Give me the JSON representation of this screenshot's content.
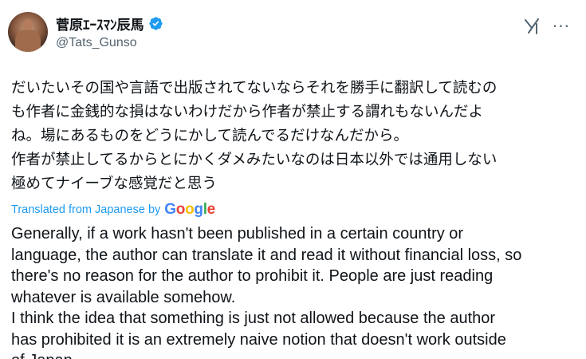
{
  "author": {
    "display_name": "菅原ｴｰｽﾏﾝ辰馬",
    "handle": "@Tats_Gunso",
    "verified": true,
    "verified_color": "#1d9bf0"
  },
  "icons": {
    "grok": "grok-icon",
    "more": "more-options-icon",
    "more_glyph": "···"
  },
  "tweet": {
    "original_text": "だいたいその国や言語で出版されてないならそれを勝手に翻訳して読むの\nも作者に金銭的な損はないわけだから作者が禁止する謂れもないんだよ\nね。場にあるものをどうにかして読んでるだけなんだから。\n作者が禁止してるからとにかくダメみたいなのは日本以外では通用しない\n極めてナイーブな感覚だと思う",
    "translated_from_label": "Translated from Japanese by",
    "translator_brand": "Google",
    "translation_text": "Generally, if a work hasn't been published in a certain country or\nlanguage, the author can translate it and read it without financial loss, so\nthere's no reason for the author to prohibit it. People are just reading\nwhatever is available somehow.\nI think the idea that something is just not allowed because the author\nhas prohibited it is an extremely naive notion that doesn't work outside\nof Japan."
  },
  "colors": {
    "link_blue": "#1d9bf0",
    "secondary_text": "#536471",
    "primary_text": "#0f1419"
  }
}
